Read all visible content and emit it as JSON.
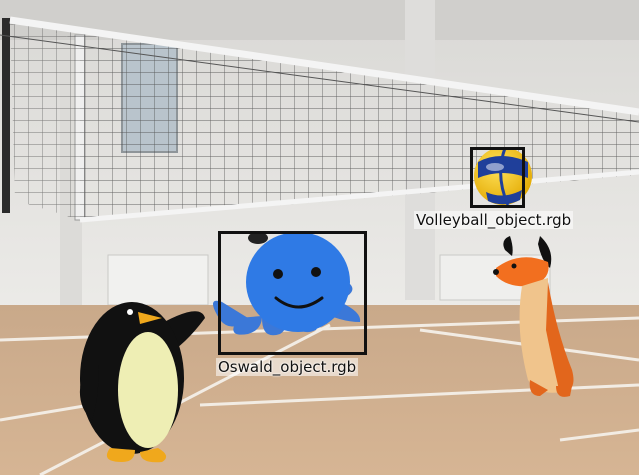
{
  "scene": {
    "description_colors": {
      "wall": "#e4e3e0",
      "floor": "#cfae8c",
      "court_lines": "#f2ece4",
      "net_band": "#f4f4f4",
      "box_stroke": "#111111"
    },
    "objects": [
      {
        "label": "Oswald_object.rgb",
        "icon": "octopus-character"
      },
      {
        "label": "Volleyball_object.rgb",
        "icon": "volleyball"
      }
    ],
    "characters": [
      {
        "icon": "penguin-character"
      },
      {
        "icon": "dachshund-character"
      }
    ]
  }
}
